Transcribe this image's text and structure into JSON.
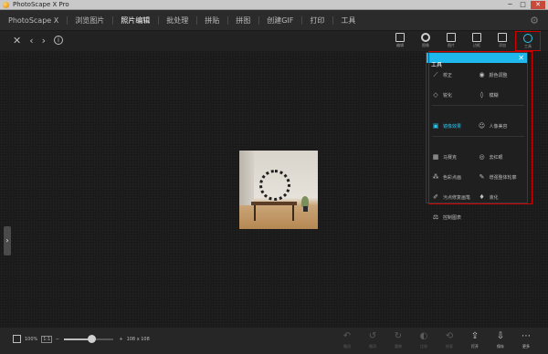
{
  "titlebar": {
    "title": "PhotoScape X Pro",
    "minimize": "─",
    "maximize": "□",
    "close": "✕"
  },
  "tabs": [
    {
      "label": "PhotoScape X",
      "active": false
    },
    {
      "label": "浏览图片",
      "active": false
    },
    {
      "label": "照片编辑",
      "active": true
    },
    {
      "label": "批处理",
      "active": false
    },
    {
      "label": "拼贴",
      "active": false
    },
    {
      "label": "拼图",
      "active": false
    },
    {
      "label": "创建GIF",
      "active": false
    },
    {
      "label": "打印",
      "active": false
    },
    {
      "label": "工具",
      "active": false
    }
  ],
  "tab_gear_icon": "gear-icon",
  "nav": {
    "close": "✕",
    "prev": "‹",
    "next": "›",
    "info": "i"
  },
  "tools": [
    {
      "label": "编辑",
      "icon": "edit-icon"
    },
    {
      "label": "图像",
      "icon": "circle-icon"
    },
    {
      "label": "图片",
      "icon": "image-icon"
    },
    {
      "label": "边框",
      "icon": "frame-icon"
    },
    {
      "label": "添加",
      "icon": "add-icon"
    },
    {
      "label": "工具",
      "icon": "palette-icon",
      "selected": true
    }
  ],
  "tools_panel": {
    "title": "工具",
    "close": "✕",
    "items": [
      {
        "label": "校正",
        "glyph": "⟋"
      },
      {
        "label": "颜色调整",
        "glyph": "◉"
      },
      {
        "label": "锐化",
        "glyph": "◇"
      },
      {
        "label": "模糊",
        "glyph": "◊"
      },
      {
        "label": "镜像效果",
        "glyph": "▣",
        "active": true
      },
      {
        "label": "人像美容",
        "glyph": "☺"
      },
      {
        "label": "马赛克",
        "glyph": "▦"
      },
      {
        "label": "去红眼",
        "glyph": "◎"
      },
      {
        "label": "色彩点画",
        "glyph": "⁂"
      },
      {
        "label": "增强整体轮廓",
        "glyph": "✎"
      },
      {
        "label": "污点修复画笔",
        "glyph": "✐"
      },
      {
        "label": "液化",
        "glyph": "♦"
      },
      {
        "label": "控制图表",
        "glyph": "⚖"
      }
    ]
  },
  "side_handle": "›",
  "bottombar": {
    "zoom_percent": "100%",
    "one_to_one": "1:1",
    "minus": "─",
    "plus": "+",
    "image_size": "108 x 108",
    "zoom_slider_value": 0.55,
    "buttons": [
      {
        "label": "撤消",
        "glyph": "↶",
        "on": false
      },
      {
        "label": "撤消",
        "glyph": "↺",
        "on": false
      },
      {
        "label": "重做",
        "glyph": "↻",
        "on": false
      },
      {
        "label": "比较",
        "glyph": "◐",
        "on": false
      },
      {
        "label": "恢复",
        "glyph": "⟲",
        "on": false
      },
      {
        "label": "打开",
        "glyph": "⇪",
        "on": true
      },
      {
        "label": "保存",
        "glyph": "⇩",
        "on": true
      },
      {
        "label": "更多",
        "glyph": "⋯",
        "on": true
      }
    ]
  }
}
